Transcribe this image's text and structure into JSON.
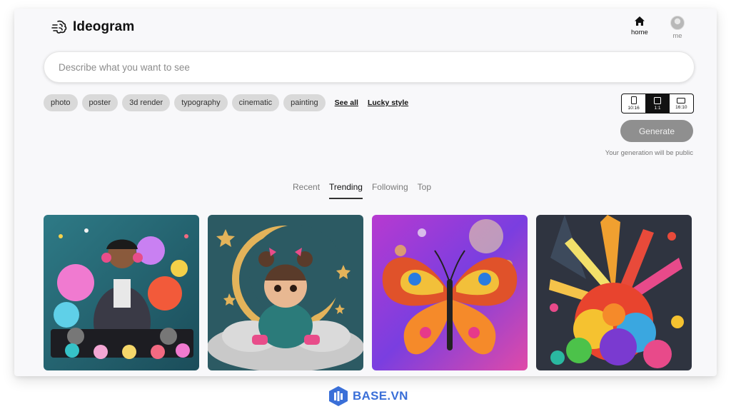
{
  "app": {
    "name": "Ideogram"
  },
  "nav": {
    "home_label": "home",
    "me_label": "me",
    "home_icon": "home-icon",
    "me_icon": "avatar"
  },
  "search": {
    "placeholder": "Describe what you want to see",
    "value": ""
  },
  "chips": [
    "photo",
    "poster",
    "3d render",
    "typography",
    "cinematic",
    "painting"
  ],
  "links": {
    "see_all": "See all",
    "lucky_style": "Lucky style"
  },
  "aspect_ratios": [
    {
      "label": "10:16",
      "selected": false
    },
    {
      "label": "1:1",
      "selected": true
    },
    {
      "label": "16:10",
      "selected": false
    }
  ],
  "generate": {
    "label": "Generate",
    "note": "Your generation will be public"
  },
  "tabs": [
    {
      "label": "Recent",
      "active": false
    },
    {
      "label": "Trending",
      "active": true
    },
    {
      "label": "Following",
      "active": false
    },
    {
      "label": "Top",
      "active": false
    }
  ],
  "gallery": [
    {
      "subject": "dj-with-headphones"
    },
    {
      "subject": "child-on-cloud-with-moon"
    },
    {
      "subject": "colorful-butterfly"
    },
    {
      "subject": "paint-splash-explosion"
    }
  ],
  "watermark": {
    "text": "BASE.VN"
  },
  "colors": {
    "accent": "#111111",
    "chip_bg": "#d9d9d9",
    "generate_bg": "#8f8f8f",
    "watermark": "#3a6fd8"
  }
}
